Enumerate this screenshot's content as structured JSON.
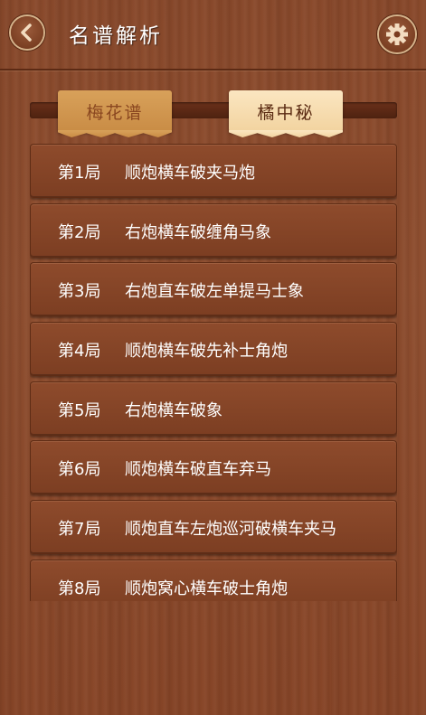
{
  "header": {
    "title": "名谱解析"
  },
  "tabs": [
    {
      "label": "梅花谱",
      "active": false
    },
    {
      "label": "橘中秘",
      "active": true
    }
  ],
  "games": [
    {
      "num": "第1局",
      "name": "顺炮横车破夹马炮"
    },
    {
      "num": "第2局",
      "name": "右炮横车破缠角马象"
    },
    {
      "num": "第3局",
      "name": "右炮直车破左单提马士象"
    },
    {
      "num": "第4局",
      "name": "顺炮横车破先补士角炮"
    },
    {
      "num": "第5局",
      "name": "右炮横车破象"
    },
    {
      "num": "第6局",
      "name": "顺炮横车破直车弃马"
    },
    {
      "num": "第7局",
      "name": "顺炮直车左炮巡河破横车夹马"
    },
    {
      "num": "第8局",
      "name": "顺炮窝心横车破士角炮"
    }
  ],
  "colors": {
    "wood": "#8a4a2c",
    "tab_active": "#f2d39f",
    "tab_inactive": "#d8a15a"
  }
}
